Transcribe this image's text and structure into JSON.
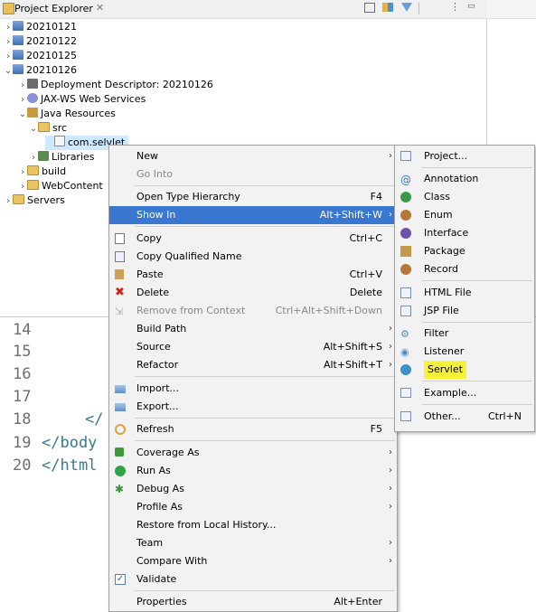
{
  "explorer": {
    "title": "Project Explorer",
    "close": "✕",
    "tree": [
      {
        "label": "20210121"
      },
      {
        "label": "20210122"
      },
      {
        "label": "20210125"
      },
      {
        "label": "20210126"
      },
      {
        "label": "Deployment Descriptor: 20210126"
      },
      {
        "label": "JAX-WS Web Services"
      },
      {
        "label": "Java Resources"
      },
      {
        "label": "src"
      },
      {
        "label": "com.selvlet"
      },
      {
        "label": "Libraries"
      },
      {
        "label": "build"
      },
      {
        "label": "WebContent"
      },
      {
        "label": "Servers"
      }
    ]
  },
  "editor": {
    "line_numbers": [
      "14",
      "15",
      "16",
      "17",
      "18",
      "19",
      "20"
    ],
    "lines": {
      "l18": "</",
      "l19": "</body",
      "l20": "</html"
    }
  },
  "context_menu": {
    "items": [
      {
        "label": "New",
        "shortcut": ""
      },
      {
        "label": "Go Into",
        "shortcut": ""
      },
      {
        "label": "Open Type Hierarchy",
        "shortcut": "F4"
      },
      {
        "label": "Show In",
        "shortcut": "Alt+Shift+W"
      },
      {
        "label": "Copy",
        "shortcut": "Ctrl+C"
      },
      {
        "label": "Copy Qualified Name",
        "shortcut": ""
      },
      {
        "label": "Paste",
        "shortcut": "Ctrl+V"
      },
      {
        "label": "Delete",
        "shortcut": "Delete"
      },
      {
        "label": "Remove from Context",
        "shortcut": "Ctrl+Alt+Shift+Down"
      },
      {
        "label": "Build Path",
        "shortcut": ""
      },
      {
        "label": "Source",
        "shortcut": "Alt+Shift+S"
      },
      {
        "label": "Refactor",
        "shortcut": "Alt+Shift+T"
      },
      {
        "label": "Import...",
        "shortcut": ""
      },
      {
        "label": "Export...",
        "shortcut": ""
      },
      {
        "label": "Refresh",
        "shortcut": "F5"
      },
      {
        "label": "Coverage As",
        "shortcut": ""
      },
      {
        "label": "Run As",
        "shortcut": ""
      },
      {
        "label": "Debug As",
        "shortcut": ""
      },
      {
        "label": "Profile As",
        "shortcut": ""
      },
      {
        "label": "Restore from Local History...",
        "shortcut": ""
      },
      {
        "label": "Team",
        "shortcut": ""
      },
      {
        "label": "Compare With",
        "shortcut": ""
      },
      {
        "label": "Validate",
        "shortcut": ""
      },
      {
        "label": "Properties",
        "shortcut": "Alt+Enter"
      }
    ]
  },
  "submenu": {
    "items": [
      {
        "label": "Project...",
        "shortcut": ""
      },
      {
        "label": "Annotation",
        "shortcut": ""
      },
      {
        "label": "Class",
        "shortcut": ""
      },
      {
        "label": "Enum",
        "shortcut": ""
      },
      {
        "label": "Interface",
        "shortcut": ""
      },
      {
        "label": "Package",
        "shortcut": ""
      },
      {
        "label": "Record",
        "shortcut": ""
      },
      {
        "label": "HTML File",
        "shortcut": ""
      },
      {
        "label": "JSP File",
        "shortcut": ""
      },
      {
        "label": "Filter",
        "shortcut": ""
      },
      {
        "label": "Listener",
        "shortcut": ""
      },
      {
        "label": "Servlet",
        "shortcut": ""
      },
      {
        "label": "Example...",
        "shortcut": ""
      },
      {
        "label": "Other...",
        "shortcut": "Ctrl+N"
      }
    ]
  },
  "colors": {
    "accent": "#3a77d0",
    "highlight": "#f8f23a"
  }
}
